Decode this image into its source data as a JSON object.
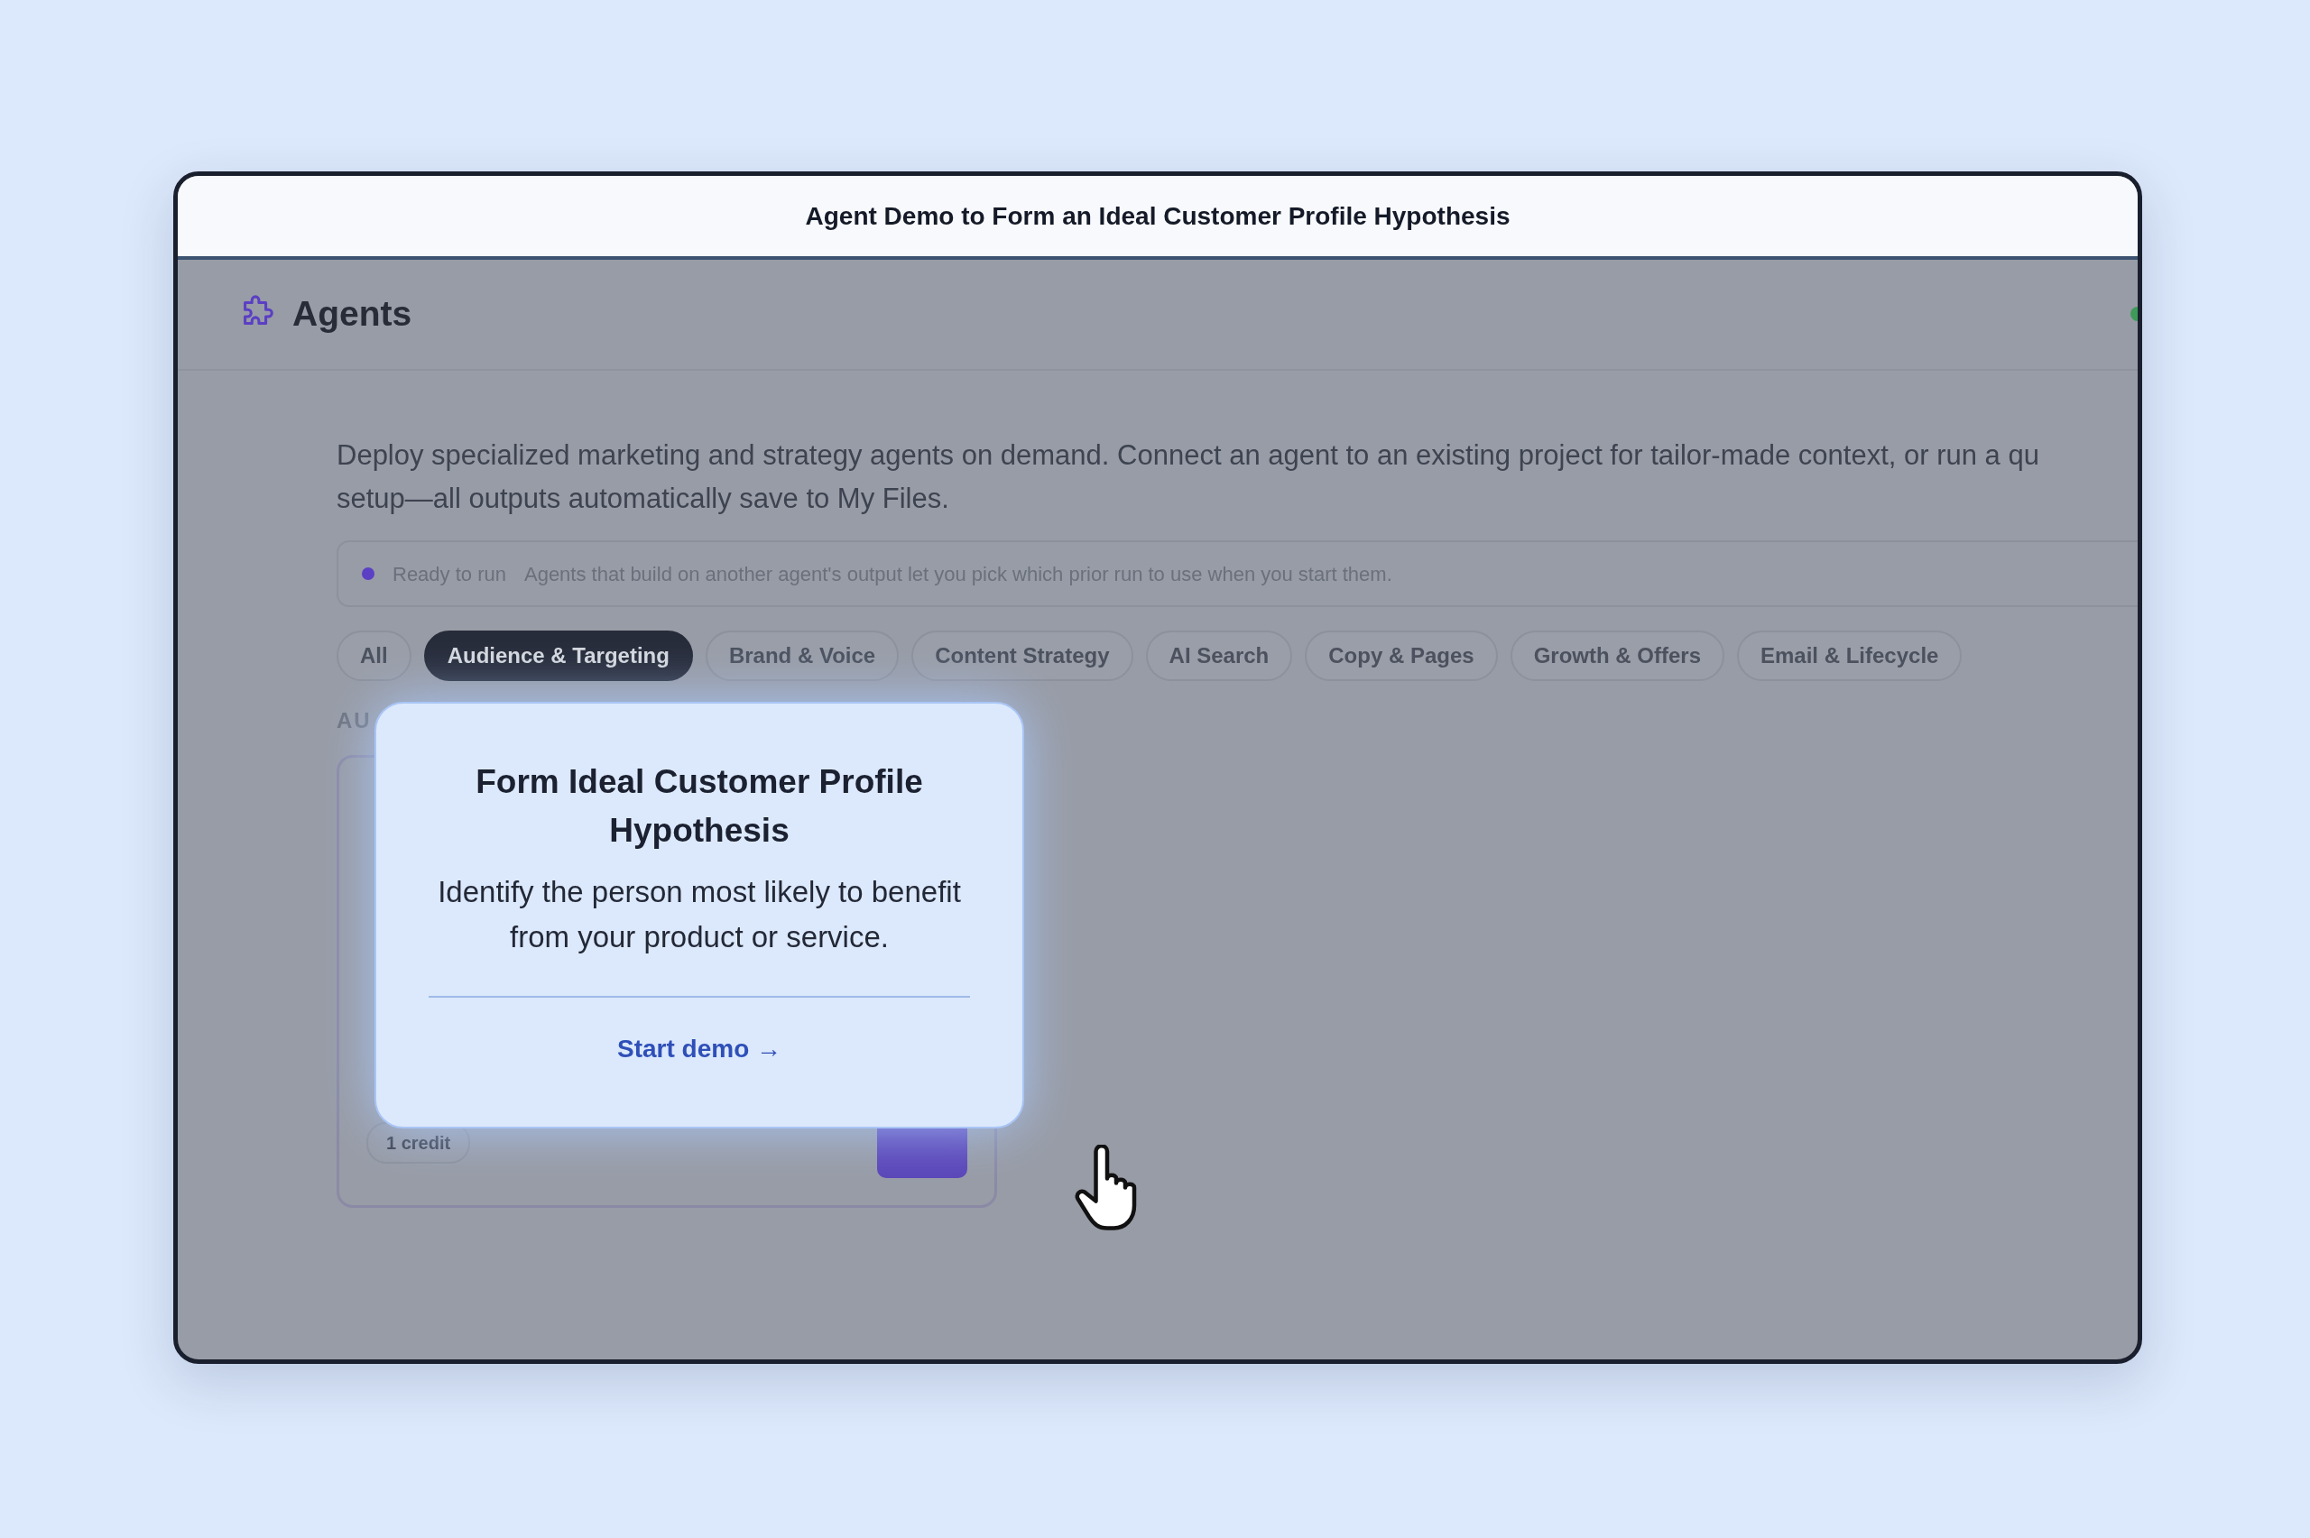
{
  "window": {
    "title": "Agent Demo to Form an Ideal Customer Profile Hypothesis"
  },
  "header": {
    "title": "Agents"
  },
  "intro": {
    "lines": [
      "Deploy specialized marketing and strategy agents on demand. Connect an agent to an existing project for tailor-made context, or run a qu",
      "setup—all outputs automatically save to My Files."
    ]
  },
  "notice": {
    "status": "Ready to run",
    "text": "Agents that build on another agent's output let you pick which prior run to use when you start them."
  },
  "filters": [
    {
      "label": "All",
      "selected": false
    },
    {
      "label": "Audience & Targeting",
      "selected": true
    },
    {
      "label": "Brand & Voice",
      "selected": false
    },
    {
      "label": "Content Strategy",
      "selected": false
    },
    {
      "label": "AI Search",
      "selected": false
    },
    {
      "label": "Copy & Pages",
      "selected": false
    },
    {
      "label": "Growth & Offers",
      "selected": false
    },
    {
      "label": "Email & Lifecycle",
      "selected": false
    }
  ],
  "section": {
    "label": "AU"
  },
  "card": {
    "credits": "1 credit"
  },
  "popover": {
    "title": "Form Ideal Customer Profile Hypothesis",
    "text": "Identify the person most likely to benefit from your product or service.",
    "link": "Start demo →"
  }
}
